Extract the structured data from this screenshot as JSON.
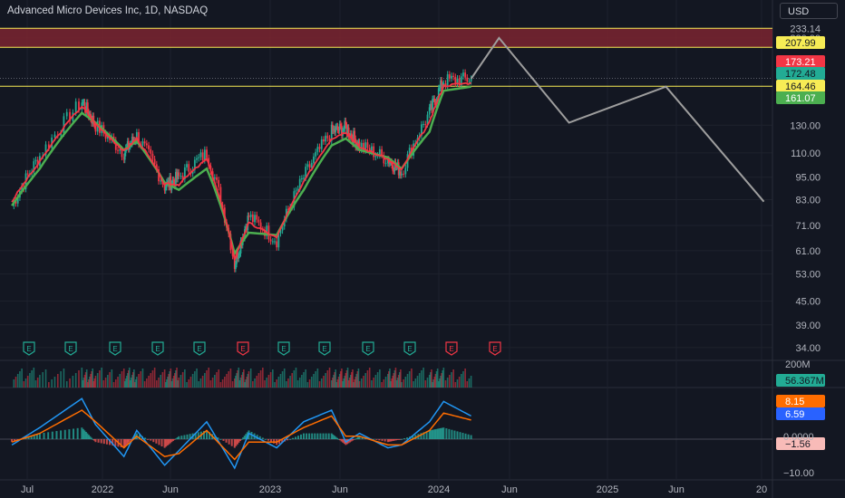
{
  "header": {
    "title": "Advanced Micro Devices Inc, 1D, NASDAQ",
    "currency": "USD"
  },
  "chart_data": {
    "type": "line",
    "title": "Advanced Micro Devices Inc, 1D, NASDAQ",
    "price_axis_ticks": [
      "233.14",
      "220.00",
      "130.00",
      "110.00",
      "95.00",
      "83.00",
      "71.00",
      "61.00",
      "53.00",
      "45.00",
      "39.00",
      "34.00"
    ],
    "price_tags": [
      {
        "label": "207.99",
        "color": "#f7ec55",
        "text_color": "#131722"
      },
      {
        "label": "173.21",
        "color": "#f23645",
        "text_color": "#ffffff"
      },
      {
        "label": "172.48",
        "color": "#22ab94",
        "text_color": "#131722"
      },
      {
        "label": "164.46",
        "color": "#f7ec55",
        "text_color": "#131722"
      },
      {
        "label": "161.07",
        "color": "#4caf50",
        "text_color": "#ffffff"
      }
    ],
    "time_axis_labels": [
      "Jul",
      "2022",
      "Jun",
      "2023",
      "Jun",
      "2024",
      "Jun",
      "2025",
      "Jun",
      "20"
    ],
    "price_series": {
      "name": "AMD close",
      "x": [
        "2021-06",
        "2021-08",
        "2021-11",
        "2021-12",
        "2022-02",
        "2022-03",
        "2022-05",
        "2022-06",
        "2022-08",
        "2022-10",
        "2022-11",
        "2023-01",
        "2023-03",
        "2023-05",
        "2023-06",
        "2023-07",
        "2023-09",
        "2023-10",
        "2023-12",
        "2024-01",
        "2024-03"
      ],
      "values": [
        80,
        108,
        150,
        130,
        110,
        122,
        90,
        95,
        110,
        56,
        75,
        65,
        95,
        125,
        128,
        115,
        106,
        98,
        140,
        170,
        172
      ]
    },
    "moving_average_green": [
      80,
      100,
      140,
      132,
      112,
      118,
      92,
      88,
      100,
      60,
      68,
      67,
      88,
      115,
      120,
      112,
      107,
      100,
      125,
      160,
      164
    ],
    "moving_average_red": [
      82,
      104,
      146,
      131,
      111,
      120,
      91,
      91,
      106,
      58,
      72,
      66,
      92,
      120,
      125,
      114,
      106,
      99,
      132,
      165,
      168
    ],
    "projection": {
      "x": [
        "2024-03",
        "2024-05",
        "2024-10",
        "2025-05",
        "2025-12"
      ],
      "values": [
        172,
        220,
        132,
        164,
        82
      ]
    },
    "resistance_zone": [
      "207.99",
      "233.14"
    ],
    "levels": [
      "164.46",
      "207.99"
    ],
    "volume": {
      "label": "200M",
      "last": "56.367M",
      "last_color": "#22ab94"
    },
    "macd": {
      "ticks": [
        "0.0000",
        "−10.00"
      ],
      "tags": [
        {
          "label": "8.15",
          "color": "#ff6d00",
          "text_color": "#ffffff"
        },
        {
          "label": "6.59",
          "color": "#2962ff",
          "text_color": "#ffffff"
        },
        {
          "label": "−1.56",
          "color": "#f8bbb8",
          "text_color": "#131722"
        }
      ],
      "macd_line": [
        -2,
        4,
        14,
        5,
        -6,
        3,
        -9,
        -4,
        6,
        -10,
        2,
        -3,
        6,
        10,
        -1,
        2,
        -3,
        -2,
        6,
        13,
        8
      ],
      "signal_line": [
        -1,
        2,
        10,
        6,
        -3,
        1,
        -6,
        -5,
        3,
        -7,
        -1,
        -1,
        4,
        8,
        1,
        1,
        -2,
        -2,
        3,
        9,
        6.6
      ]
    },
    "earnings_markers": [
      {
        "label": "E",
        "color": "#22ab94"
      },
      {
        "label": "E",
        "color": "#22ab94"
      },
      {
        "label": "E",
        "color": "#22ab94"
      },
      {
        "label": "E",
        "color": "#22ab94"
      },
      {
        "label": "E",
        "color": "#22ab94"
      },
      {
        "label": "E",
        "color": "#f23645"
      },
      {
        "label": "E",
        "color": "#22ab94"
      },
      {
        "label": "E",
        "color": "#22ab94"
      },
      {
        "label": "E",
        "color": "#22ab94"
      },
      {
        "label": "E",
        "color": "#22ab94"
      },
      {
        "label": "E",
        "color": "#f23645"
      },
      {
        "label": "E",
        "color": "#f23645"
      }
    ],
    "colors": {
      "background": "#131722",
      "up": "#22ab94",
      "down": "#f23645",
      "ma_green": "#4caf50",
      "ma_red": "#f23645",
      "projection": "#9e9e9e",
      "zone": "#7b2430",
      "level": "#f7ec55",
      "macd": "#2196f3",
      "signal": "#ff6d00"
    }
  }
}
